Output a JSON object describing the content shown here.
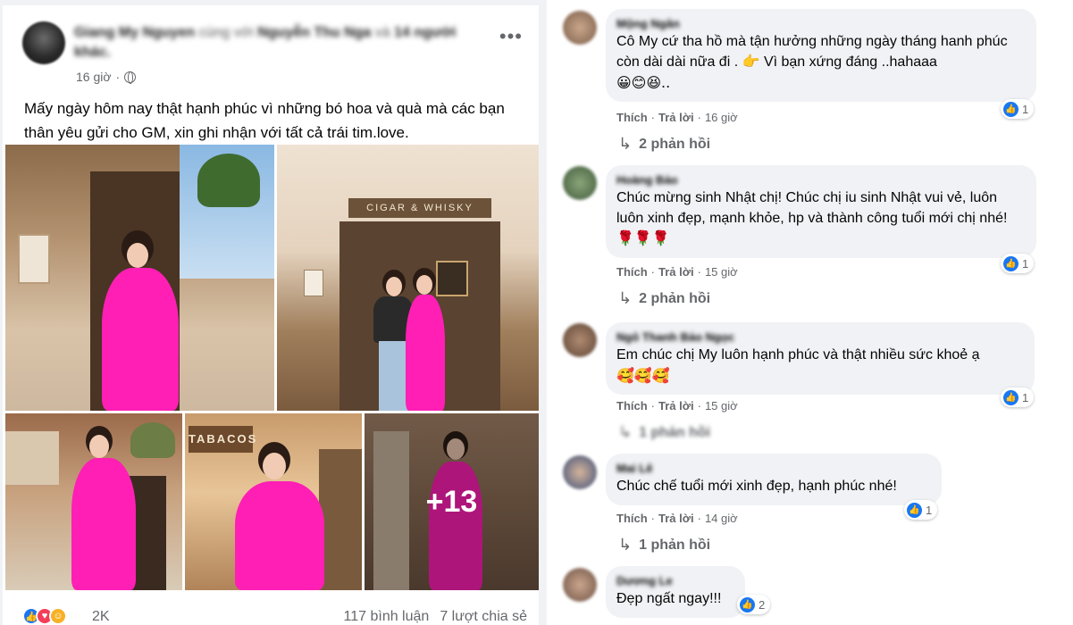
{
  "post": {
    "author": "Giang My Nguyen",
    "with_word": "cùng với",
    "tagged": "Nguyễn Thu Nga",
    "and_word": "và",
    "others": "14 người khác.",
    "time": "16 giờ",
    "more_icon": "more-horizontal-icon",
    "text": "Mấy ngày hôm nay thật hạnh phúc vì những bó hoa và quà mà các bạn thân yêu gửi cho GM, xin ghi nhận với tất cả trái tim.love.",
    "photo_sign": "CIGAR & WHISKY",
    "photo_sign2": "TABACOS",
    "more_photos": "+13",
    "reaction_count": "2K",
    "comment_count": "117 bình luận",
    "share_count": "7 lượt chia sẻ"
  },
  "colors": {
    "accent": "#1877f2",
    "dress": "#ff1fb4",
    "bubble": "#f0f2f5",
    "meta_text": "#65676b"
  },
  "comments": [
    {
      "name": "Mộng Ngân",
      "text": "Cô My cứ tha hồ mà tận hưởng những ngày tháng hanh phúc còn dài dài nữa đi . 👉 Vì bạn xứng đáng ..hahaaa",
      "emoji": "😀😊😆..",
      "like": "Thích",
      "reply": "Trả lời",
      "time": "16 giờ",
      "likes": "1",
      "replies": "2 phản hồi"
    },
    {
      "name": "Hoàng Bảo",
      "text": "Chúc mừng sinh Nhật chị! Chúc chị iu sinh Nhật vui vẻ, luôn luôn xinh đẹp, mạnh khỏe, hp và thành công tuổi mới chị nhé! 🌹🌹🌹",
      "like": "Thích",
      "reply": "Trả lời",
      "time": "15 giờ",
      "likes": "1",
      "replies": "2 phản hồi"
    },
    {
      "name": "Ngô Thanh Bảo Ngọc",
      "text": "Em chúc chị My luôn hạnh phúc và thật nhiều sức khoẻ ạ",
      "emoji": "🥰🥰🥰",
      "like": "Thích",
      "reply": "Trả lời",
      "time": "15 giờ",
      "likes": "1",
      "replies": "1 phản hồi"
    },
    {
      "name": "Mai Lê",
      "text": "Chúc chế tuổi mới xinh đẹp, hạnh phúc nhé!",
      "like": "Thích",
      "reply": "Trả lời",
      "time": "14 giờ",
      "likes": "1",
      "replies": "1 phản hồi"
    },
    {
      "name": "Dương Le",
      "text": "Đẹp ngất ngay!!!",
      "likes": "2"
    }
  ]
}
